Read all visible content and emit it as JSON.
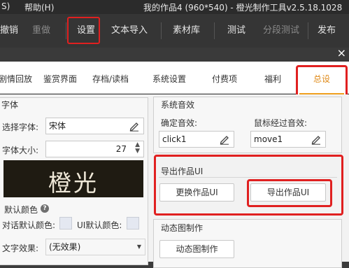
{
  "titlebar": {
    "item_s": "S)",
    "help_menu": "帮助(H)",
    "window_title": "我的作品4 (960*540) - 橙光制作工具v2.5.18.1028"
  },
  "toolbar": {
    "undo": "撤销",
    "redo": "重做",
    "settings": "设置",
    "text_import": "文本导入",
    "assets": "素材库",
    "test": "测试",
    "segment_test": "分段测试",
    "publish": "发布"
  },
  "dialog": {
    "close_symbol": "×"
  },
  "tabs": [
    {
      "label": "剧情回放"
    },
    {
      "label": "鉴赏界面"
    },
    {
      "label": "存档/读档"
    },
    {
      "label": "系统设置"
    },
    {
      "label": "付费项"
    },
    {
      "label": "福利"
    },
    {
      "label": "总设"
    }
  ],
  "font_panel": {
    "title": "字体",
    "select_font_label": "选择字体:",
    "font_value": "宋体",
    "font_size_label": "字体大小:",
    "font_size_value": "27",
    "preview_text": "橙光",
    "default_color_label": "默认颜色",
    "dialog_color_label": "对话默认颜色:",
    "ui_color_label": "UI默认颜色:",
    "text_effect_label": "文字效果:",
    "text_effect_value": "(无效果)"
  },
  "sound_panel": {
    "title": "系统音效",
    "confirm_label": "确定音效:",
    "confirm_value": "click1",
    "hover_label": "鼠标经过音效:",
    "hover_value": "move1"
  },
  "export_panel": {
    "title": "导出作品UI",
    "replace_button": "更换作品UI",
    "export_button": "导出作品UI"
  },
  "animation_panel": {
    "title": "动态图制作",
    "button": "动态图制作"
  },
  "colors": {
    "highlight_red": "#e02020",
    "active_tab_orange": "#e08a18",
    "preview_bg": "#1f1b12",
    "color_swatch": "#e4e8f1"
  }
}
